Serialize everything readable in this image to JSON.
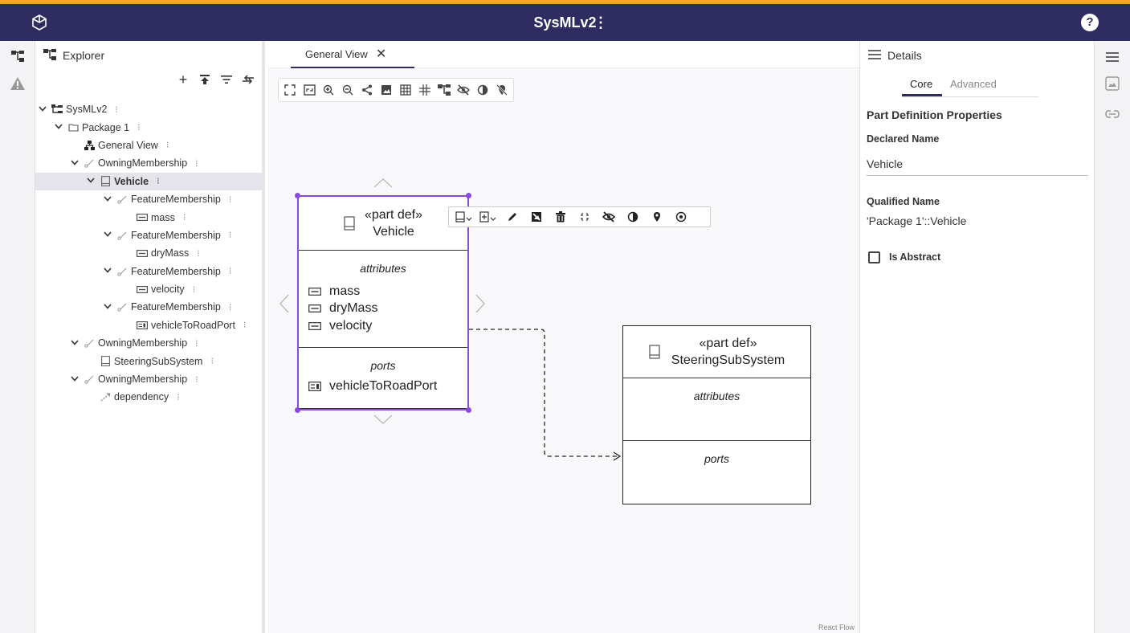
{
  "app": {
    "title": "SysMLv2",
    "title_menu": "⋮",
    "help": "?"
  },
  "explorer": {
    "title": "Explorer",
    "tree": [
      {
        "label": "SysMLv2",
        "depth": 0,
        "chevron": "v",
        "icon": "project-icon"
      },
      {
        "label": "Package 1",
        "depth": 1,
        "chevron": "v",
        "icon": "folder-icon"
      },
      {
        "label": "General View",
        "depth": 2,
        "chevron": "",
        "icon": "diagram-icon"
      },
      {
        "label": "OwningMembership",
        "depth": 2,
        "chevron": "v",
        "icon": "membership-icon"
      },
      {
        "label": "Vehicle",
        "depth": 3,
        "chevron": "v",
        "icon": "part-def-icon",
        "selected": true
      },
      {
        "label": "FeatureMembership",
        "depth": 4,
        "chevron": "v",
        "icon": "membership-icon"
      },
      {
        "label": "mass",
        "depth": 5,
        "chevron": "",
        "icon": "attribute-icon"
      },
      {
        "label": "FeatureMembership",
        "depth": 4,
        "chevron": "v",
        "icon": "membership-icon"
      },
      {
        "label": "dryMass",
        "depth": 5,
        "chevron": "",
        "icon": "attribute-icon"
      },
      {
        "label": "FeatureMembership",
        "depth": 4,
        "chevron": "v",
        "icon": "membership-icon"
      },
      {
        "label": "velocity",
        "depth": 5,
        "chevron": "",
        "icon": "attribute-icon"
      },
      {
        "label": "FeatureMembership",
        "depth": 4,
        "chevron": "v",
        "icon": "membership-icon"
      },
      {
        "label": "vehicleToRoadPort",
        "depth": 5,
        "chevron": "",
        "icon": "port-icon"
      },
      {
        "label": "OwningMembership",
        "depth": 2,
        "chevron": "v",
        "icon": "membership-icon"
      },
      {
        "label": "SteeringSubSystem",
        "depth": 3,
        "chevron": "",
        "icon": "part-def-icon"
      },
      {
        "label": "OwningMembership",
        "depth": 2,
        "chevron": "v",
        "icon": "membership-icon"
      },
      {
        "label": "dependency",
        "depth": 3,
        "chevron": "",
        "icon": "dependency-icon"
      }
    ],
    "more_glyph": "⁝"
  },
  "diagram": {
    "tab_label": "General View",
    "tab_close": "✕",
    "watermark": "React Flow",
    "vehicle": {
      "stereotype": "«part def»",
      "name": "Vehicle",
      "attributes_title": "attributes",
      "attributes": [
        "mass",
        "dryMass",
        "velocity"
      ],
      "ports_title": "ports",
      "ports": [
        "vehicleToRoadPort"
      ]
    },
    "steering": {
      "stereotype": "«part def»",
      "name": "SteeringSubSystem",
      "attributes_title": "attributes",
      "ports_title": "ports"
    }
  },
  "details": {
    "title": "Details",
    "tabs": [
      "Core",
      "Advanced"
    ],
    "section_title": "Part Definition Properties",
    "declared_name_label": "Declared Name",
    "declared_name_value": "Vehicle",
    "qualified_name_label": "Qualified Name",
    "qualified_name_value": "'Package 1'::Vehicle",
    "is_abstract_label": "Is Abstract",
    "is_abstract": false
  },
  "colors": {
    "header": "#2f2c62",
    "accent": "#f5a623",
    "selection": "#8a4bdc"
  }
}
